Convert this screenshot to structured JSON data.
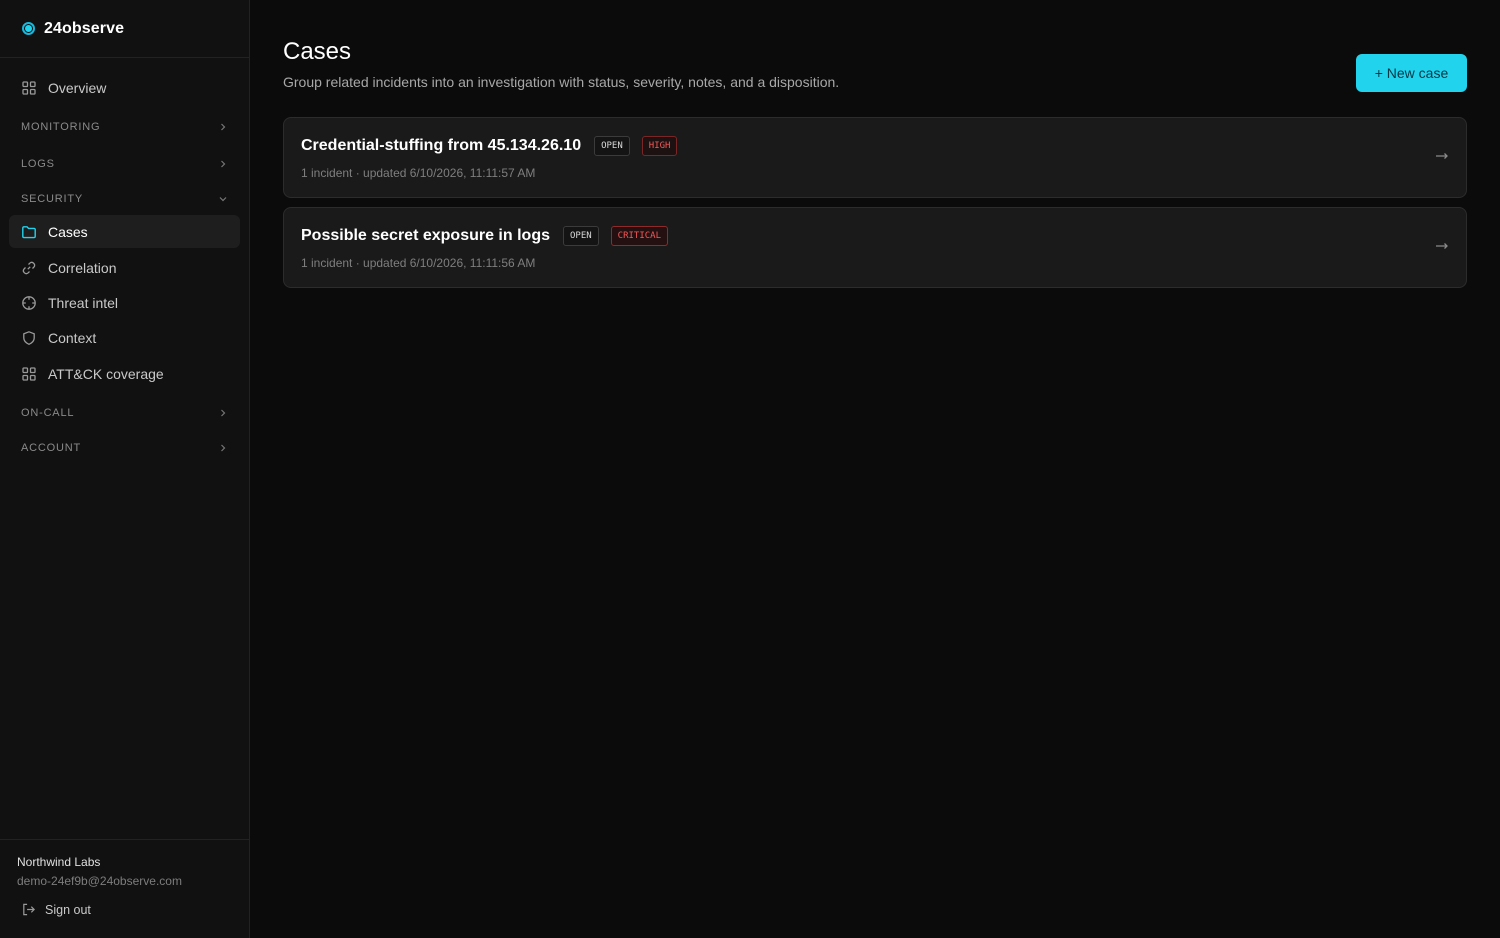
{
  "brand": {
    "name": "24observe",
    "accent": "#22d3ee"
  },
  "sidebar": {
    "overview": {
      "label": "Overview",
      "icon": "grid-icon"
    },
    "sections": {
      "monitoring": "MONITORING",
      "logs": "LOGS",
      "security": "SECURITY",
      "oncall": "ON-CALL",
      "account": "ACCOUNT"
    },
    "security_items": [
      {
        "label": "Cases",
        "icon": "folder-icon",
        "active": true
      },
      {
        "label": "Correlation",
        "icon": "link-icon"
      },
      {
        "label": "Threat intel",
        "icon": "crosshair-icon"
      },
      {
        "label": "Context",
        "icon": "shield-icon"
      },
      {
        "label": "ATT&CK coverage",
        "icon": "grid-icon"
      }
    ],
    "footer": {
      "org": "Northwind Labs",
      "email": "demo-24ef9b@24observe.com",
      "signout": "Sign out"
    }
  },
  "page": {
    "title": "Cases",
    "subtitle": "Group related incidents into an investigation with status, severity, notes, and a disposition.",
    "new_button": "+ New case"
  },
  "cases": [
    {
      "title": "Credential-stuffing from 45.134.26.10",
      "status": "OPEN",
      "severity": "HIGH",
      "meta": "1 incident · updated 6/10/2026, 11:11:57 AM"
    },
    {
      "title": "Possible secret exposure in logs",
      "status": "OPEN",
      "severity": "CRITICAL",
      "meta": "1 incident · updated 6/10/2026, 11:11:56 AM"
    }
  ]
}
